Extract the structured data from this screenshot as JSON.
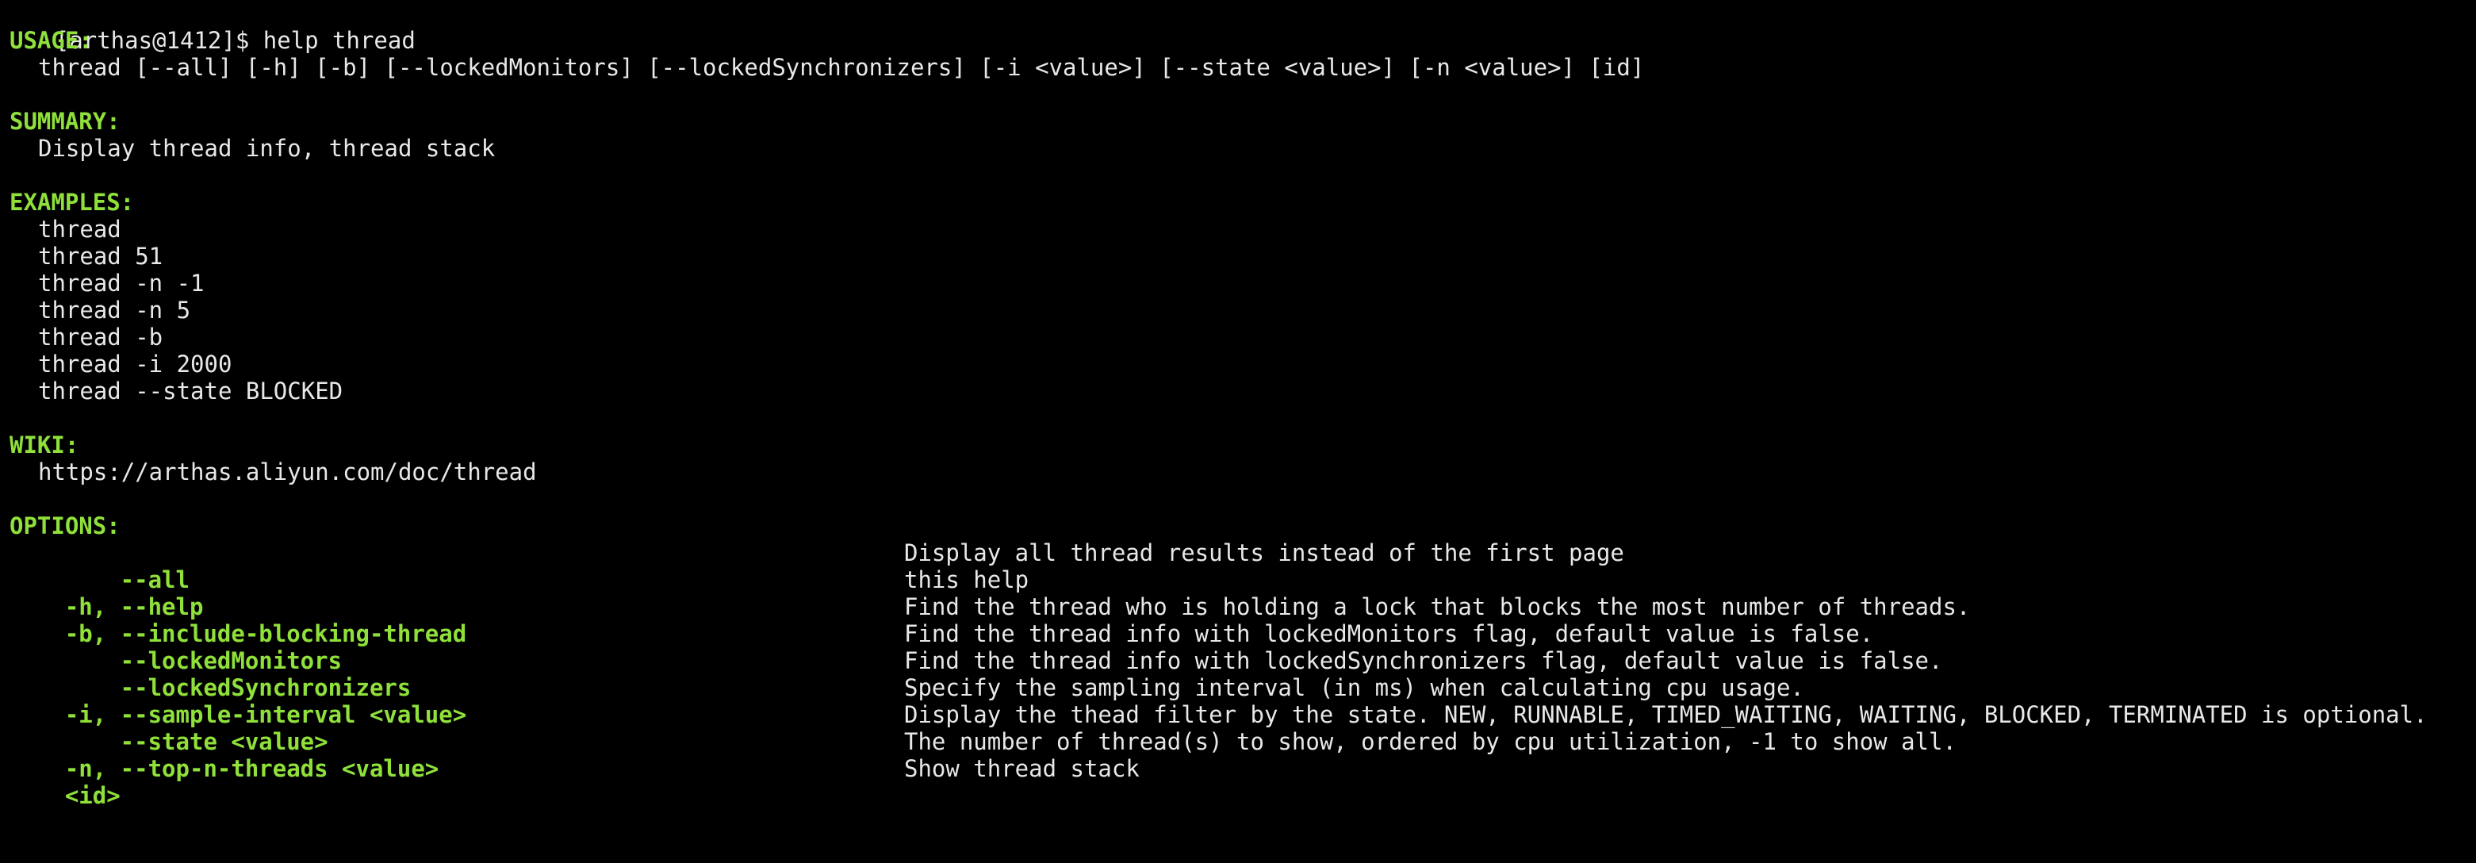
{
  "prompt": {
    "text": "[arthas@1412]$ ",
    "command": "help thread"
  },
  "usage": {
    "heading": "USAGE:",
    "text": "thread [--all] [-h] [-b] [--lockedMonitors] [--lockedSynchronizers] [-i <value>] [--state <value>] [-n <value>] [id]"
  },
  "summary": {
    "heading": "SUMMARY:",
    "text": "Display thread info, thread stack"
  },
  "examples": {
    "heading": "EXAMPLES:",
    "items": [
      "thread",
      "thread 51",
      "thread -n -1",
      "thread -n 5",
      "thread -b",
      "thread -i 2000",
      "thread --state BLOCKED"
    ]
  },
  "wiki": {
    "heading": "WIKI:",
    "url": "https://arthas.aliyun.com/doc/thread"
  },
  "options": {
    "heading": "OPTIONS:",
    "items": [
      {
        "flag": "    --all",
        "desc": "Display all thread results instead of the first page"
      },
      {
        "flag": "-h, --help",
        "desc": "this help"
      },
      {
        "flag": "-b, --include-blocking-thread",
        "desc": "Find the thread who is holding a lock that blocks the most number of threads."
      },
      {
        "flag": "    --lockedMonitors",
        "desc": "Find the thread info with lockedMonitors flag, default value is false."
      },
      {
        "flag": "    --lockedSynchronizers",
        "desc": "Find the thread info with lockedSynchronizers flag, default value is false."
      },
      {
        "flag": "-i, --sample-interval <value>",
        "desc": "Specify the sampling interval (in ms) when calculating cpu usage."
      },
      {
        "flag": "    --state <value>",
        "desc": "Display the thead filter by the state. NEW, RUNNABLE, TIMED_WAITING, WAITING, BLOCKED, TERMINATED is optional."
      },
      {
        "flag": "-n, --top-n-threads <value>",
        "desc": "The number of thread(s) to show, ordered by cpu utilization, -1 to show all."
      },
      {
        "flag": "<id>",
        "desc": "Show thread stack"
      }
    ]
  },
  "colors": {
    "background": "#000000",
    "heading": "#8fe03a",
    "text": "#e8e8e8"
  }
}
